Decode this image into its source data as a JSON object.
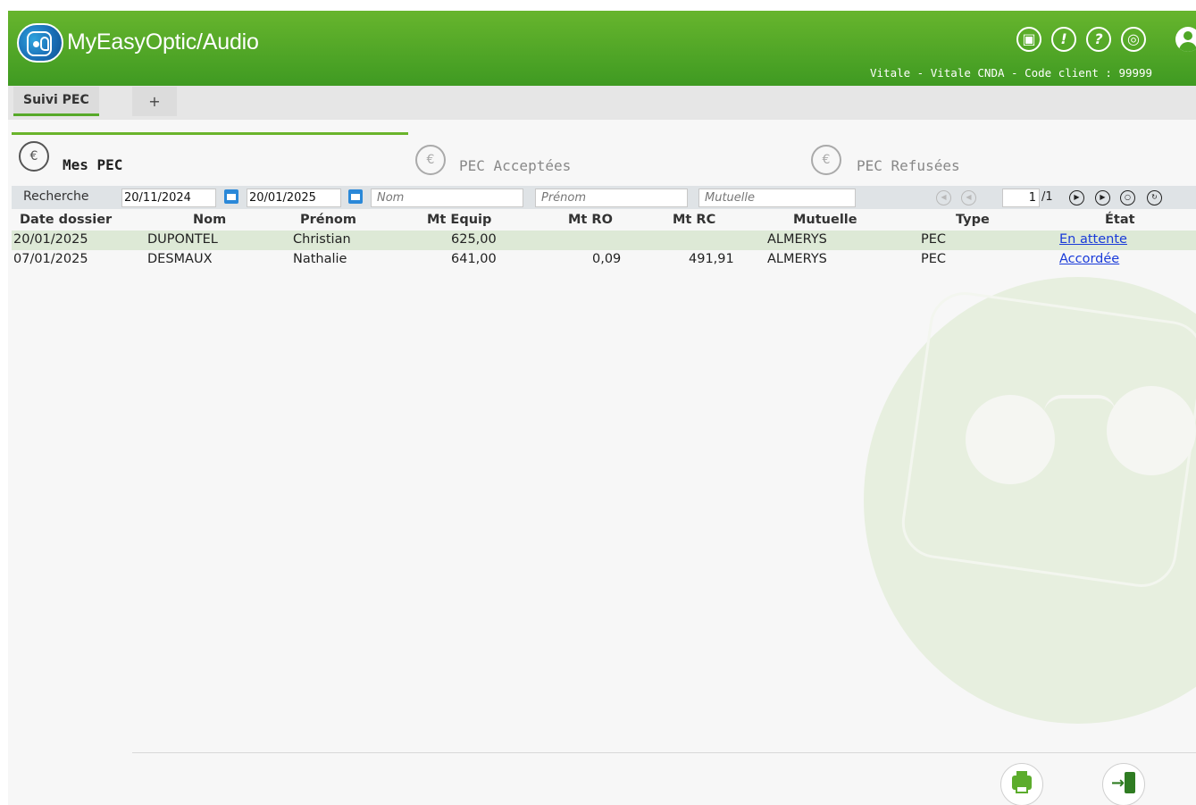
{
  "app": {
    "title": "MyEasyOptic/Audio",
    "client_info": "Vitale - Vitale CNDA - Code client : 99999"
  },
  "header_icons": [
    {
      "name": "calendar-icon",
      "glyph": "▣"
    },
    {
      "name": "alert-icon",
      "glyph": "!"
    },
    {
      "name": "help-icon",
      "glyph": "?"
    },
    {
      "name": "support-icon",
      "glyph": "◎"
    },
    {
      "name": "user-icon",
      "glyph": ""
    }
  ],
  "tabs": {
    "active": "Suivi PEC",
    "add": "+"
  },
  "sections": [
    {
      "label": "Mes PEC",
      "icon": "envelope-euro-icon",
      "active": true
    },
    {
      "label": "PEC Acceptées",
      "icon": "thumb-euro-icon",
      "active": false
    },
    {
      "label": "PEC Refusées",
      "icon": "refused-euro-icon",
      "active": false
    }
  ],
  "search": {
    "label": "Recherche",
    "date_from": "20/11/2024",
    "date_to": "20/01/2025",
    "nom_placeholder": "Nom",
    "prenom_placeholder": "Prénom",
    "mutuelle_placeholder": "Mutuelle",
    "page": "1",
    "page_total": "/1"
  },
  "table": {
    "columns": [
      "Date dossier",
      "Nom",
      "Prénom",
      "Mt Equip",
      "Mt RO",
      "Mt RC",
      "Mutuelle",
      "Type",
      "État"
    ],
    "rows": [
      {
        "date": "20/01/2025",
        "nom": "DUPONTEL",
        "prenom": "Christian",
        "mt_equip": "625,00",
        "mt_ro": "",
        "mt_rc": "",
        "mutuelle": "ALMERYS",
        "type": "PEC",
        "etat": "En attente"
      },
      {
        "date": "07/01/2025",
        "nom": "DESMAUX",
        "prenom": "Nathalie",
        "mt_equip": "641,00",
        "mt_ro": "0,09",
        "mt_rc": "491,91",
        "mutuelle": "ALMERYS",
        "type": "PEC",
        "etat": "Accordée"
      }
    ]
  },
  "colors": {
    "header_green": "#4fa726",
    "accent_green": "#6ab42b",
    "link_blue": "#1a3bd9",
    "row_highlight": "#dde9d6"
  }
}
